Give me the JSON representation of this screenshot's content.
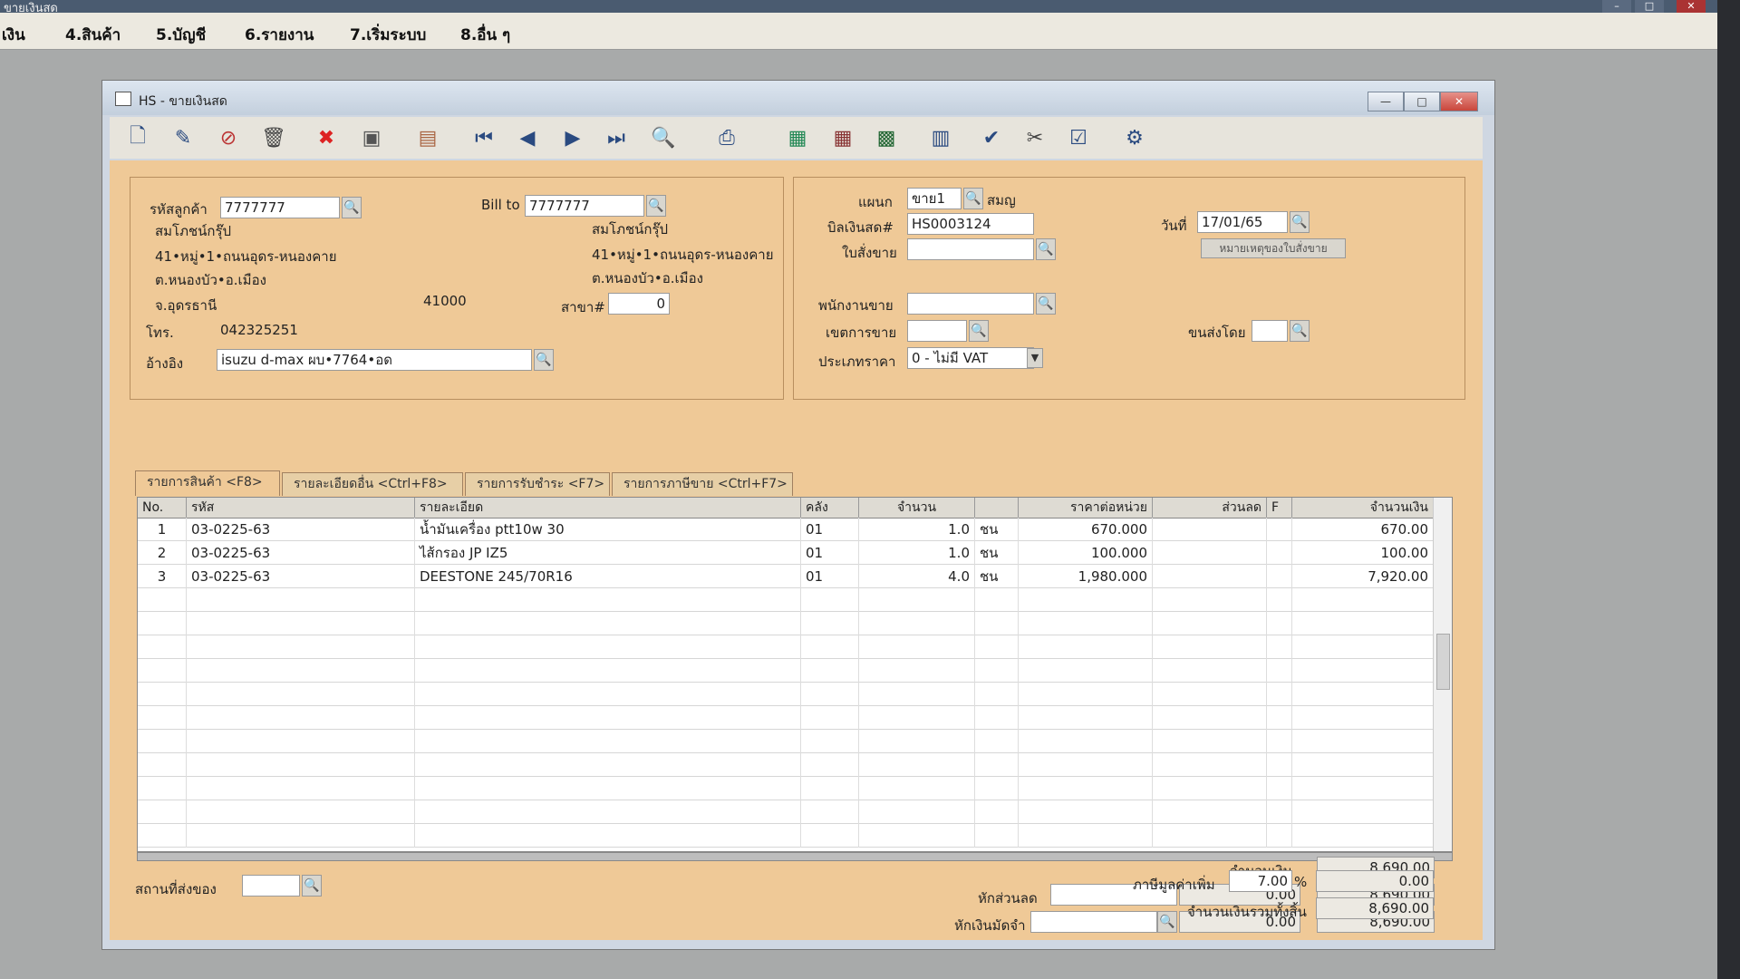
{
  "app": {
    "top_title": "ขายเงินสด",
    "window_title": "HS - ขายเงินสด"
  },
  "menu": [
    "เงิน",
    "4.สินค้า",
    "5.บัญชี",
    "6.รายงาน",
    "7.เริ่มระบบ",
    "8.อื่น ๆ"
  ],
  "toolbar_icons": [
    "new-icon",
    "edit-icon",
    "void-icon",
    "delete-icon",
    "cancel-icon",
    "save-icon",
    "books-icon",
    "first-record-icon",
    "prev-record-icon",
    "next-record-icon",
    "last-record-icon",
    "find-icon",
    "print-icon",
    "export-icon",
    "import-icon",
    "calculator-icon",
    "setup-icon",
    "approve-icon",
    "scissors-icon",
    "ok-icon",
    "network-icon"
  ],
  "customer": {
    "code_label": "รหัสลูกค้า",
    "code": "7777777",
    "name": "สมโภชน์กรุ๊ป",
    "addr1": "41•หมู่•1•ถนนอุดร-หนองคาย",
    "addr2": "ต.หนองบัว•อ.เมือง",
    "province": "จ.อุดรธานี",
    "postcode": "41000",
    "phone_label": "โทร.",
    "phone": "042325251",
    "ref_label": "อ้างอิง",
    "ref": "isuzu d-max ผบ•7764•อด"
  },
  "billto": {
    "label": "Bill to",
    "code": "7777777",
    "name": "สมโภชน์กรุ๊ป",
    "addr1": "41•หมู่•1•ถนนอุดร-หนองคาย",
    "addr2": "ต.หนองบัว•อ.เมือง",
    "branch_label": "สาขา#",
    "branch": "0"
  },
  "doc": {
    "dept_label": "แผนก",
    "dept": "ขาย1",
    "dept_name": "สมญ",
    "bill_label": "บิลเงินสด#",
    "bill_no": "HS0003124",
    "order_label": "ใบสั่งขาย",
    "order_no": "",
    "date_label": "วันที่",
    "date": "17/01/65",
    "note_button": "หมายเหตุของใบสั่งขาย",
    "salesman_label": "พนักงานขาย",
    "salesman": "",
    "area_label": "เขตการขาย",
    "area": "",
    "ship_label": "ขนส่งโดย",
    "ship": "",
    "pricetype_label": "ประเภทราคา",
    "pricetype": "0 - ไม่มี VAT"
  },
  "tabs": [
    "รายการสินค้า <F8>",
    "รายละเอียดอื่น <Ctrl+F8>",
    "รายการรับชำระ <F7>",
    "รายการภาษีขาย <Ctrl+F7>"
  ],
  "grid": {
    "headers": [
      "No.",
      "รหัส",
      "รายละเอียด",
      "คลัง",
      "จำนวน",
      "",
      "ราคาต่อหน่วย",
      "ส่วนลด",
      "F",
      "จำนวนเงิน"
    ],
    "rows": [
      {
        "no": "1",
        "code": "03-0225-63",
        "desc": "น้ำมันเครื่อง ptt10w 30",
        "wh": "01",
        "qty": "1.0",
        "unit": "ชน",
        "price": "670.000",
        "disc": "",
        "f": "",
        "amount": "670.00"
      },
      {
        "no": "2",
        "code": "03-0225-63",
        "desc": "ไส้กรอง JP IZ5",
        "wh": "01",
        "qty": "1.0",
        "unit": "ชน",
        "price": "100.000",
        "disc": "",
        "f": "",
        "amount": "100.00"
      },
      {
        "no": "3",
        "code": "03-0225-63",
        "desc": "DEESTONE 245/70R16",
        "wh": "01",
        "qty": "4.0",
        "unit": "ชน",
        "price": "1,980.000",
        "disc": "",
        "f": "",
        "amount": "7,920.00"
      }
    ]
  },
  "footer": {
    "deliver_label": "สถานที่ส่งของ",
    "deliver": "",
    "amount_label": "จำนวนเงิน",
    "amount": "8,690.00",
    "discount_label": "หักส่วนลด",
    "discount_pct": "",
    "discount_amt": "0.00",
    "after_discount": "8,690.00",
    "deposit_label": "หักเงินมัดจำ",
    "deposit_ref": "",
    "deposit_amt": "0.00",
    "after_deposit": "8,690.00",
    "vat_label": "ภาษีมูลค่าเพิ่ม",
    "vat_rate": "7.00",
    "vat_pct_sign": "%",
    "vat_amt": "0.00",
    "total_label": "จำนวนเงินรวมทั้งสิ้น",
    "total": "8,690.00"
  }
}
